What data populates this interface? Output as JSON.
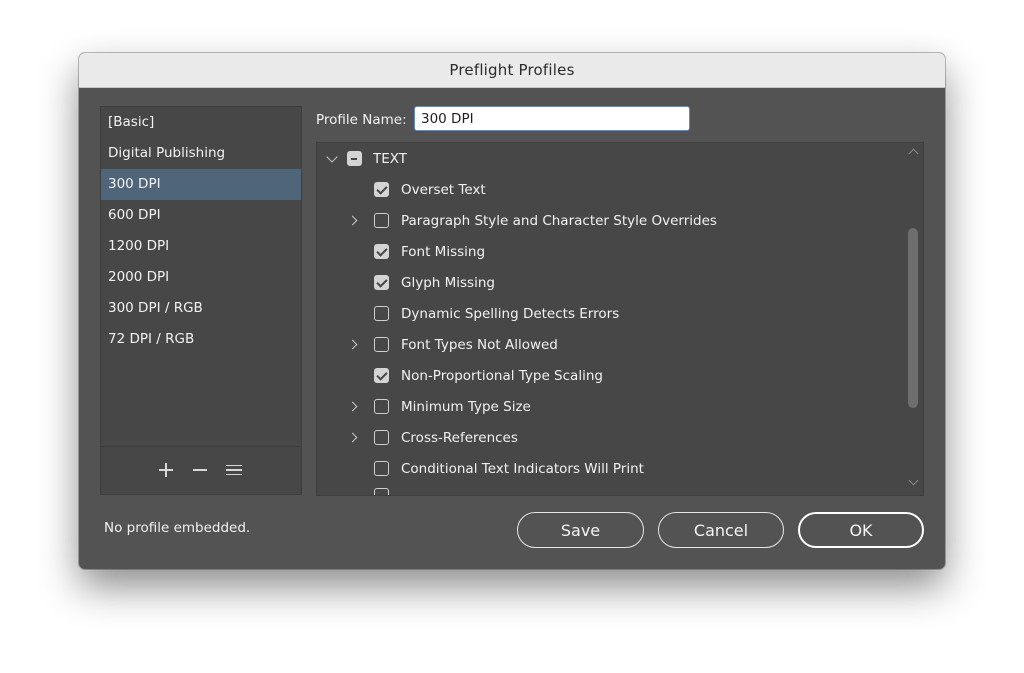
{
  "dialog": {
    "title": "Preflight Profiles"
  },
  "profiles": {
    "selected": "300 DPI",
    "items": [
      {
        "label": "[Basic]"
      },
      {
        "label": "Digital Publishing"
      },
      {
        "label": "300 DPI"
      },
      {
        "label": "600 DPI"
      },
      {
        "label": "1200 DPI"
      },
      {
        "label": "2000 DPI"
      },
      {
        "label": "300 DPI / RGB"
      },
      {
        "label": "72 DPI / RGB"
      }
    ],
    "toolbar_icons": [
      "plus-icon",
      "minus-icon",
      "menu-icon"
    ]
  },
  "profile_name": {
    "label": "Profile Name:",
    "value": "300 DPI"
  },
  "tree": {
    "category": {
      "label": "TEXT",
      "state": "mixed",
      "expanded": true
    },
    "rules": [
      {
        "label": "Overset Text",
        "checked": true,
        "expandable": false
      },
      {
        "label": "Paragraph Style and Character Style Overrides",
        "checked": false,
        "expandable": true
      },
      {
        "label": "Font Missing",
        "checked": true,
        "expandable": false
      },
      {
        "label": "Glyph Missing",
        "checked": true,
        "expandable": false
      },
      {
        "label": "Dynamic Spelling Detects Errors",
        "checked": false,
        "expandable": false
      },
      {
        "label": "Font Types Not Allowed",
        "checked": false,
        "expandable": true
      },
      {
        "label": "Non-Proportional Type Scaling",
        "checked": true,
        "expandable": false
      },
      {
        "label": "Minimum Type Size",
        "checked": false,
        "expandable": true
      },
      {
        "label": "Cross-References",
        "checked": false,
        "expandable": true
      },
      {
        "label": "Conditional Text Indicators Will Print",
        "checked": false,
        "expandable": false
      }
    ]
  },
  "status": {
    "text": "No profile embedded."
  },
  "buttons": {
    "save": "Save",
    "cancel": "Cancel",
    "ok": "OK"
  },
  "colors": {
    "dialog_bg": "#535353",
    "selection": "#4f6579",
    "focus_ring": "#5a8fd1"
  }
}
